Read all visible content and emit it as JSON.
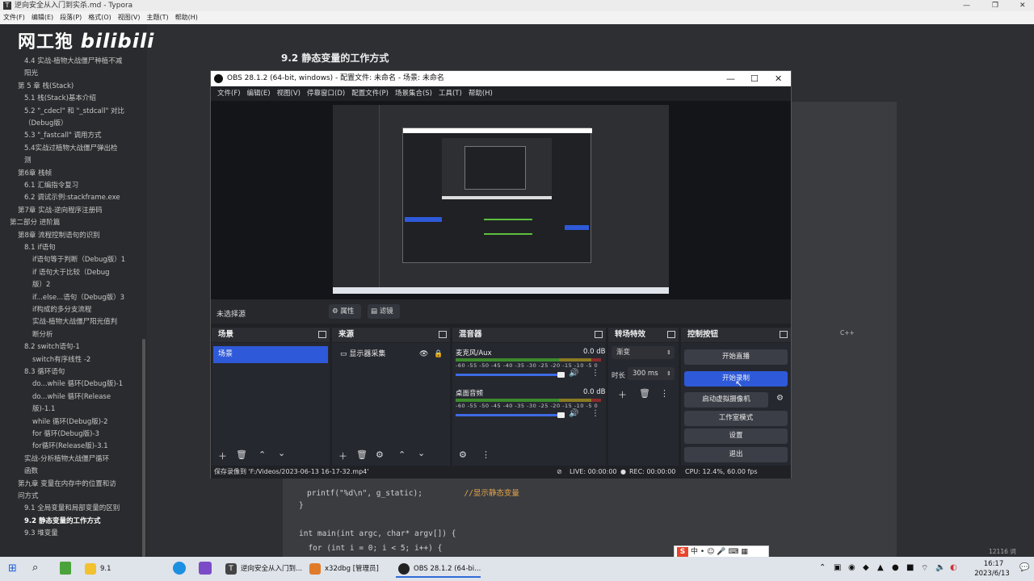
{
  "typora": {
    "title": "逆向安全从入门到实杀.md - Typora",
    "menu": [
      "文件(F)",
      "编辑(E)",
      "段落(P)",
      "格式(O)",
      "视图(V)",
      "主题(T)",
      "帮助(H)"
    ],
    "watermark": "网工狍",
    "watermark_brand": "bilibili",
    "heading": "9.2 静态变量的工作方式",
    "sidebar_items": [
      {
        "label": "4.4 实战-植物大战僵尸种植不减",
        "indent": 2
      },
      {
        "label": "阳光",
        "indent": 2
      },
      {
        "label": "第 5 章 栈(Stack)",
        "indent": 1
      },
      {
        "label": "5.1 栈(Stack)基本介绍",
        "indent": 2
      },
      {
        "label": "5.2 \"_cdecl\" 和 \"_stdcall\" 对比",
        "indent": 2
      },
      {
        "label": "（Debug版）",
        "indent": 2
      },
      {
        "label": "5.3 \"_fastcall\" 调用方式",
        "indent": 2
      },
      {
        "label": "5.4实战过植物大战僵尸弹出检",
        "indent": 2
      },
      {
        "label": "测",
        "indent": 2
      },
      {
        "label": "第6章 栈帧",
        "indent": 1
      },
      {
        "label": "6.1 汇编指令复习",
        "indent": 2
      },
      {
        "label": "6.2 调试示例:stackframe.exe",
        "indent": 2
      },
      {
        "label": "第7章 实战-逆向程序注册码",
        "indent": 1
      },
      {
        "label": "第二部分 进阶篇",
        "indent": 0
      },
      {
        "label": "第8章 流程控制语句的识别",
        "indent": 1
      },
      {
        "label": "8.1 if语句",
        "indent": 2
      },
      {
        "label": "if语句等于判断（Debug版）1",
        "indent": 3
      },
      {
        "label": "if 语句大于比较（Debug",
        "indent": 3
      },
      {
        "label": "版）2",
        "indent": 3
      },
      {
        "label": "if...else...语句（Debug版）3",
        "indent": 3
      },
      {
        "label": "if构成的多分支流程",
        "indent": 3
      },
      {
        "label": "实战-植物大战僵尸阳光值判",
        "indent": 3
      },
      {
        "label": "断分析",
        "indent": 3
      },
      {
        "label": "8.2 switch语句-1",
        "indent": 2
      },
      {
        "label": "switch有序线性 -2",
        "indent": 3
      },
      {
        "label": "8.3 循环语句",
        "indent": 2
      },
      {
        "label": "do...while 循环(Debug版)-1",
        "indent": 3
      },
      {
        "label": "do...while 循环(Release",
        "indent": 3
      },
      {
        "label": "版)-1.1",
        "indent": 3
      },
      {
        "label": "while 循环(Debug版)-2",
        "indent": 3
      },
      {
        "label": "for 循环(Debug版)-3",
        "indent": 3
      },
      {
        "label": "for循环(Release版)-3.1",
        "indent": 3
      },
      {
        "label": "实战-分析植物大战僵尸循环",
        "indent": 2
      },
      {
        "label": "函数",
        "indent": 2
      },
      {
        "label": "第九章 变量在内存中的位置和访",
        "indent": 1
      },
      {
        "label": "问方式",
        "indent": 1
      },
      {
        "label": "9.1 全局变量和局部变量的区别",
        "indent": 2
      },
      {
        "label": "9.2 静态变量的工作方式",
        "indent": 2,
        "active": true
      },
      {
        "label": "9.3 堆变量",
        "indent": 2
      }
    ],
    "code_lines": [
      {
        "text": "printf(\"%d\\n\", g_static);",
        "comment": "//显示静态变量"
      },
      {
        "text": "}",
        "comment": ""
      },
      {
        "text": "",
        "comment": ""
      },
      {
        "text": "int main(int argc, char* argv[]) {",
        "comment": ""
      },
      {
        "text": "  for (int i = 0; i < 5; i++) {",
        "comment": ""
      }
    ],
    "lang_label": "C++",
    "word_count": "12116 词",
    "bottom_icons": [
      "<",
      "</>"
    ]
  },
  "obs": {
    "title": "OBS 28.1.2 (64-bit, windows) - 配置文件: 未命名 - 场景: 未命名",
    "menu": [
      "文件(F)",
      "编辑(E)",
      "视图(V)",
      "停靠窗口(D)",
      "配置文件(P)",
      "场景集合(S)",
      "工具(T)",
      "帮助(H)"
    ],
    "no_source": "未选择源",
    "properties": "属性",
    "filters": "滤镜",
    "docks": {
      "scenes": "场景",
      "sources": "来源",
      "mixer": "混音器",
      "transitions": "转场特效",
      "controls": "控制按钮"
    },
    "scene_item": "场景",
    "source_item": "显示器采集",
    "mixer_channels": [
      {
        "name": "麦克风/Aux",
        "db": "0.0 dB"
      },
      {
        "name": "桌面音频",
        "db": "0.0 dB"
      }
    ],
    "meter_ticks": "-60 -55 -50 -45 -40 -35 -30 -25 -20 -15 -10 -5 0",
    "transition": {
      "type": "渐变",
      "duration_label": "时长",
      "duration": "300 ms"
    },
    "control_buttons": [
      {
        "label": "开始直播",
        "primary": false
      },
      {
        "label": "开始录制",
        "primary": true
      },
      {
        "label": "启动虚拟摄像机",
        "primary": false
      },
      {
        "label": "工作室模式",
        "primary": false
      },
      {
        "label": "设置",
        "primary": false
      },
      {
        "label": "退出",
        "primary": false
      }
    ],
    "status": {
      "saved": "保存录像到 'F:/Videos/2023-06-13 16-17-32.mp4'",
      "live": "LIVE: 00:00:00",
      "rec": "REC: 00:00:00",
      "cpu": "CPU: 12.4%, 60.00 fps"
    }
  },
  "taskbar": {
    "apps": [
      {
        "label": "9.1",
        "color": "#f2c12e"
      },
      {
        "label": "逆向安全从入门到...",
        "color": "#444444"
      },
      {
        "label": "x32dbg [管理员]",
        "color": "#e07b2a"
      },
      {
        "label": "OBS 28.1.2 (64-bi...",
        "color": "#222222",
        "active": true
      }
    ],
    "time": "16:17",
    "date": "2023/6/13",
    "ime_char": "中"
  }
}
